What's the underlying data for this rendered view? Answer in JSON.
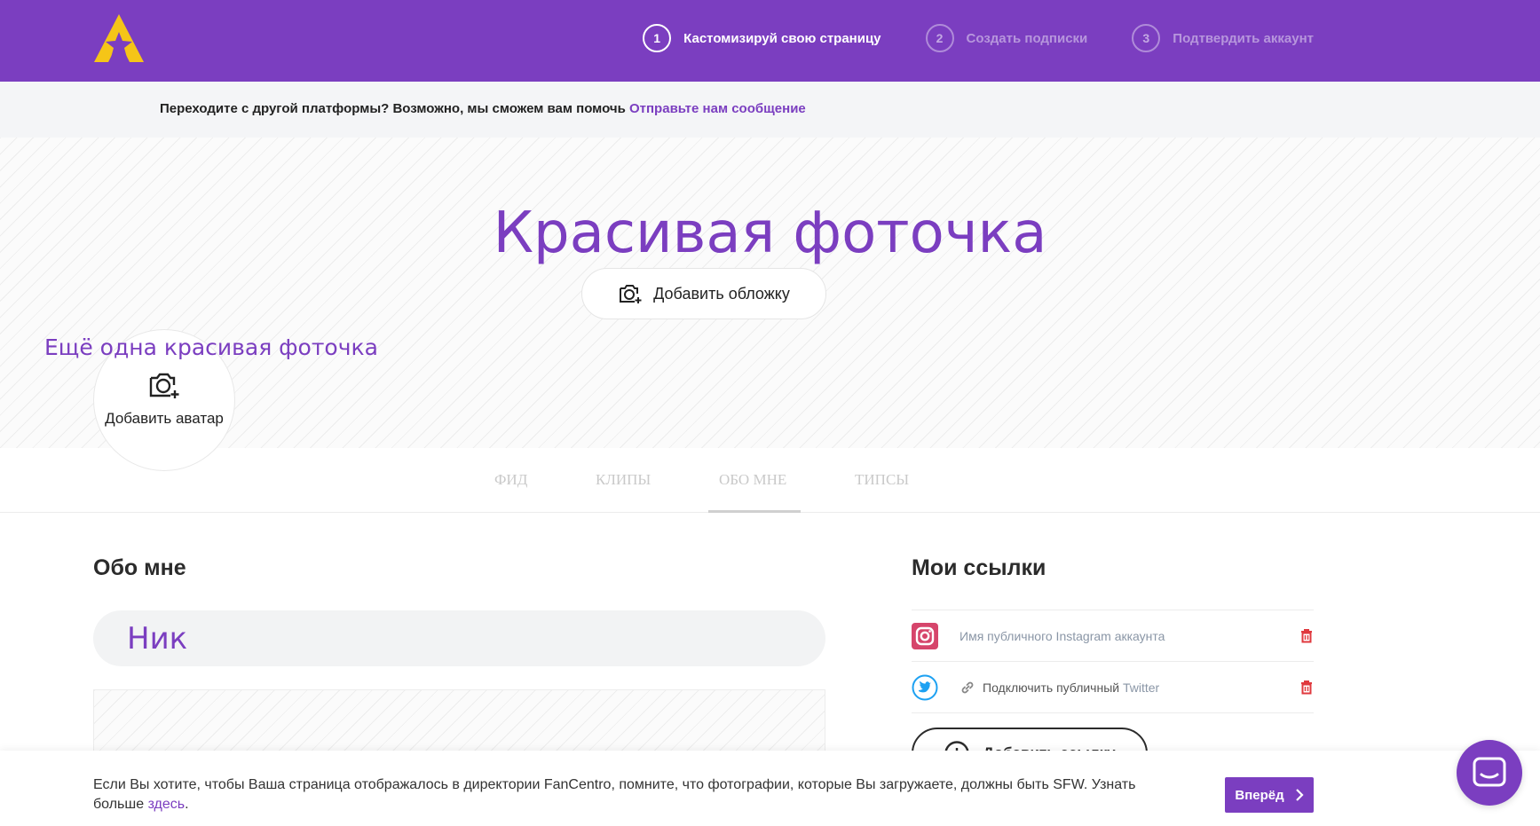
{
  "header": {
    "steps": [
      {
        "num": "1",
        "label": "Кастомизируй свою страницу"
      },
      {
        "num": "2",
        "label": "Создать подписки"
      },
      {
        "num": "3",
        "label": "Подтвердить аккаунт"
      }
    ]
  },
  "infobar": {
    "text": "Переходите с другой платформы? Возможно, мы сможем вам помочь ",
    "link": "Отправьте нам сообщение"
  },
  "cover": {
    "title": "Красивая фоточка",
    "add_cover_label": "Добавить обложку",
    "avatar_caption": "Ещё одна красивая фоточка",
    "add_avatar_label": "Добавить аватар"
  },
  "tabs": [
    "ФИД",
    "КЛИПЫ",
    "ОБО МНЕ",
    "ТИПСЫ"
  ],
  "about": {
    "title": "Обо мне",
    "nick_value": "Ник"
  },
  "links": {
    "title": "Мои ссылки",
    "instagram_placeholder": "Имя публичного Instagram аккаунта",
    "twitter_prefix": "Подключить публичный",
    "twitter_suffix": " Twitter",
    "add_label": "Добавить ссылку"
  },
  "notice": {
    "text": "Если Вы хотите, чтобы Ваша страница отображалось в директории FanCentro, помните, что фотографии, которые Вы загружаете, должны быть SFW. Узнать больше ",
    "link": "здесь",
    "link_suffix": ".",
    "next_label": "Вперёд"
  },
  "colors": {
    "brand": "#7b3ec0",
    "logo": "#f5c518",
    "instagram": "#d6456b",
    "twitter": "#1da1f2",
    "delete": "#e0393e"
  }
}
